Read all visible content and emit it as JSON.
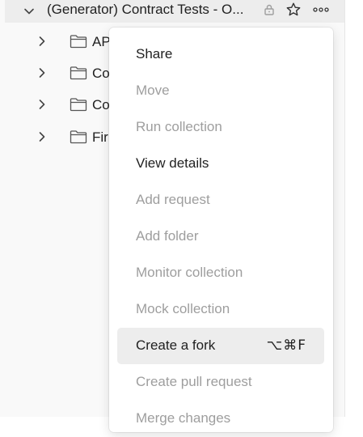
{
  "collection": {
    "title": "(Generator) Contract Tests - O..."
  },
  "folders": [
    {
      "label": "AP"
    },
    {
      "label": "Co"
    },
    {
      "label": "Co"
    },
    {
      "label": "Fir"
    }
  ],
  "menu": {
    "items": [
      {
        "label": "Share",
        "enabled": true
      },
      {
        "label": "Move",
        "enabled": false
      },
      {
        "label": "Run collection",
        "enabled": false
      },
      {
        "label": "View details",
        "enabled": true
      },
      {
        "label": "Add request",
        "enabled": false
      },
      {
        "label": "Add folder",
        "enabled": false
      },
      {
        "label": "Monitor collection",
        "enabled": false
      },
      {
        "label": "Mock collection",
        "enabled": false
      },
      {
        "label": "Create a fork",
        "enabled": true,
        "shortcut": "⌥⌘F",
        "highlighted": true
      },
      {
        "label": "Create pull request",
        "enabled": false
      },
      {
        "label": "Merge changes",
        "enabled": false
      }
    ]
  },
  "icons": {
    "collection_chevron": "chevron-down-icon",
    "folder_chevron": "chevron-right-icon",
    "folder": "folder-icon",
    "lock": "lock-icon",
    "star": "star-icon",
    "more": "more-horizontal-icon"
  },
  "colors": {
    "enabled_text": "#212121",
    "disabled_text": "#9e9e9e",
    "hover_bg": "#ededed",
    "row_bg": "#ededed"
  }
}
